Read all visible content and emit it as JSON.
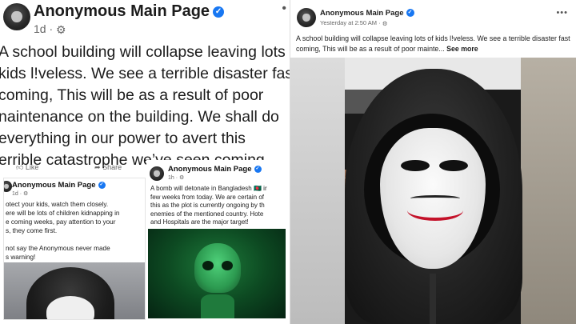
{
  "left_post": {
    "page_name": "Anonymous Main Page",
    "time": "1d ·",
    "text_lines": [
      " A school building will collapse leaving lots o",
      "kids l!veless. We see a terrible disaster fast",
      "coming, This will be as a result of poor",
      "naintenance on the building. We shall do",
      "everything in our power to avert this",
      "errible catastrophe we’ve seen coming."
    ],
    "like_label": "Like",
    "share_label": "Share"
  },
  "small_post_1": {
    "page_name": "Anonymous Main Page",
    "time": "1d ·",
    "text_lines": [
      "otect your kids, watch them closely.",
      "ere will be lots of children kidnapping in",
      "e coming weeks, pay attention to your",
      "s, they come first.",
      "",
      "not say the Anonymous never made",
      "s warning!"
    ]
  },
  "small_post_2": {
    "page_name": "Anonymous Main Page",
    "time": "1h ·",
    "text_lines": [
      "A bomb will detonate in Bangladesh 🇧🇩 ir",
      "few weeks from today. We are certain of",
      "this as the plot is currently ongoing by th",
      "enemies of the mentioned country. Hote",
      "and Hospitals are the major target!"
    ]
  },
  "right_post": {
    "page_name": "Anonymous Main Page",
    "time": "Yesterday at 2:50 AM ·",
    "text": "A school building will collapse leaving lots of kids l!veless. We see a terrible disaster fast coming, This will be as a result of poor mainte...",
    "see_more": "See more",
    "menu_icon": "more-dots-icon"
  },
  "colors": {
    "verified_blue": "#1877f2",
    "mask_mouth_red": "#c4122a",
    "matrix_green": "#1d7a3a"
  }
}
